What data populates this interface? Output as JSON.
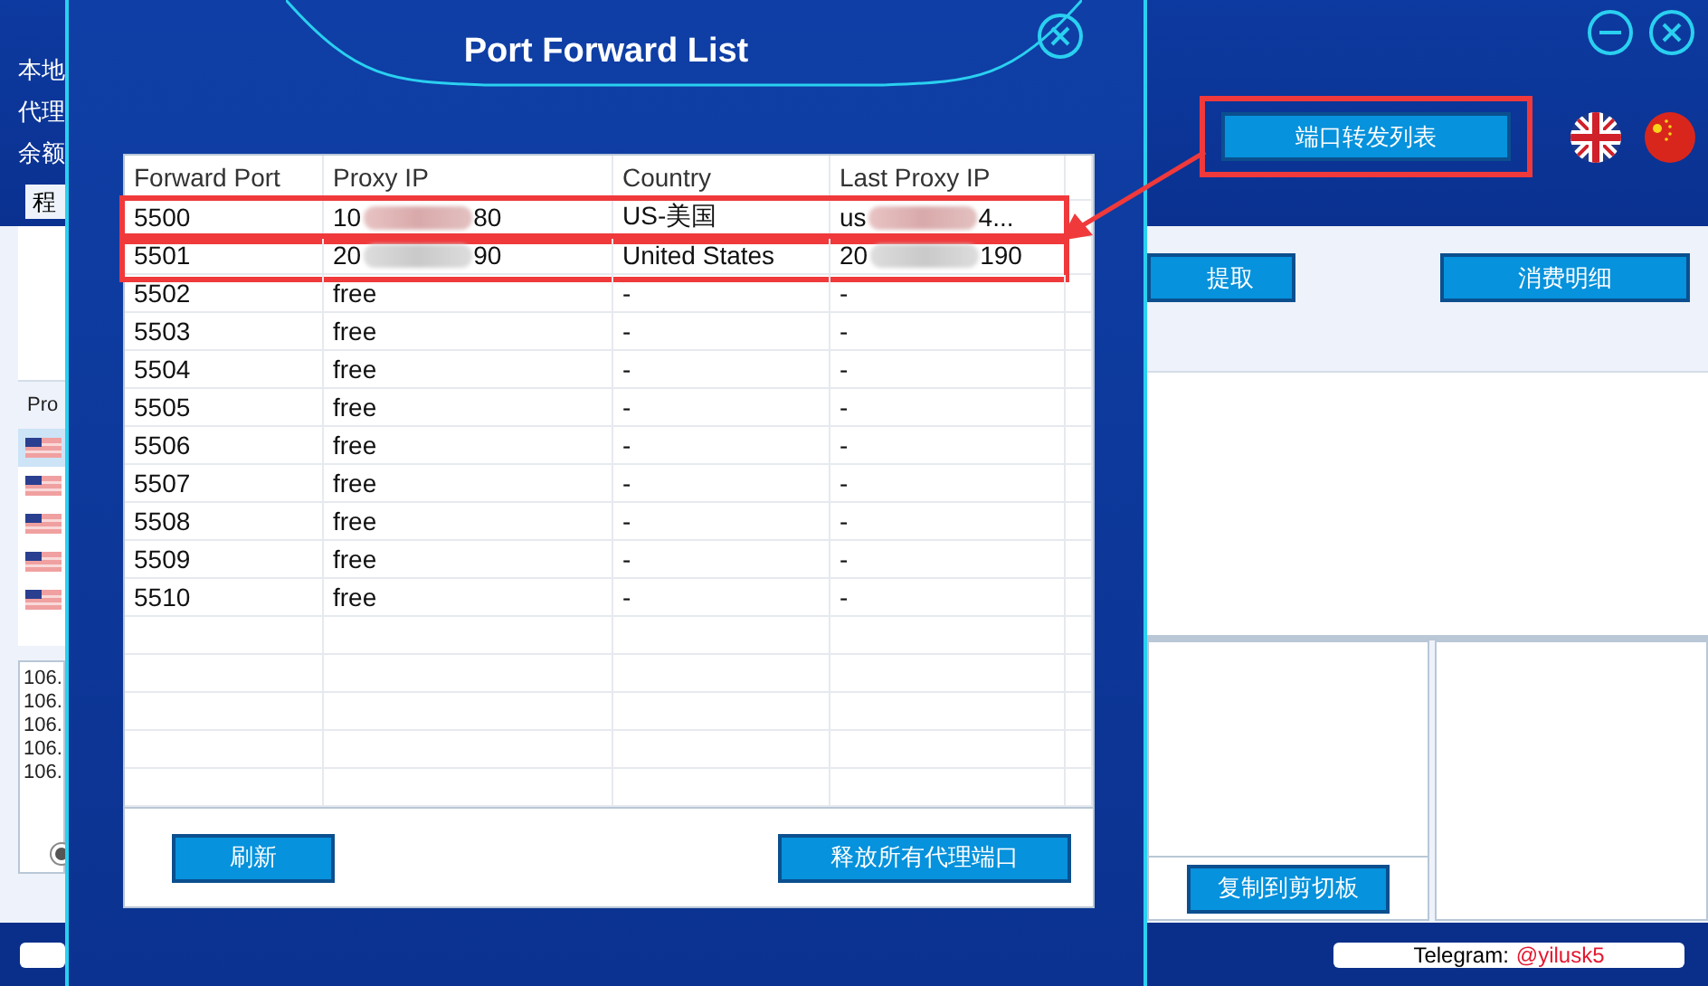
{
  "app": {
    "side_labels": [
      "本地",
      "代理",
      "余额"
    ],
    "tab": "程",
    "list_header": "Pro",
    "list_rows": [
      {
        "selected": true
      },
      {
        "selected": false
      },
      {
        "selected": false
      },
      {
        "selected": false
      },
      {
        "selected": false
      }
    ],
    "log_lines": [
      "106.",
      "106.",
      "106.",
      "106.",
      "106."
    ],
    "radio": {
      "selected": true
    },
    "port_forward_button": {
      "label": "端口转发列表",
      "annotated": true
    },
    "extract_button": "提取",
    "details_button": "消费明细",
    "copy_button": "复制到剪切板",
    "telegram": {
      "label": "Telegram:",
      "handle": "@yilusk5"
    }
  },
  "modal": {
    "title": "Port Forward List",
    "columns": [
      "Forward Port",
      "Proxy IP",
      "Country",
      "Last Proxy IP"
    ],
    "rows": [
      {
        "port": "5500",
        "proxy_ip": {
          "head": "10",
          "tail": "80"
        },
        "country": "US-美国",
        "last_proxy_ip": {
          "head": "us",
          "tail": "4..."
        },
        "highlighted": true
      },
      {
        "port": "5501",
        "proxy_ip": {
          "head": "20",
          "tail": "90"
        },
        "country": "United States",
        "last_proxy_ip": {
          "head": "20",
          "tail": "190"
        },
        "highlighted": true
      },
      {
        "port": "5502",
        "proxy_ip": {
          "head": "free"
        },
        "country": "-",
        "last_proxy_ip": {
          "head": "-"
        },
        "highlighted": false
      },
      {
        "port": "5503",
        "proxy_ip": {
          "head": "free"
        },
        "country": "-",
        "last_proxy_ip": {
          "head": "-"
        },
        "highlighted": false
      },
      {
        "port": "5504",
        "proxy_ip": {
          "head": "free"
        },
        "country": "-",
        "last_proxy_ip": {
          "head": "-"
        },
        "highlighted": false
      },
      {
        "port": "5505",
        "proxy_ip": {
          "head": "free"
        },
        "country": "-",
        "last_proxy_ip": {
          "head": "-"
        },
        "highlighted": false
      },
      {
        "port": "5506",
        "proxy_ip": {
          "head": "free"
        },
        "country": "-",
        "last_proxy_ip": {
          "head": "-"
        },
        "highlighted": false
      },
      {
        "port": "5507",
        "proxy_ip": {
          "head": "free"
        },
        "country": "-",
        "last_proxy_ip": {
          "head": "-"
        },
        "highlighted": false
      },
      {
        "port": "5508",
        "proxy_ip": {
          "head": "free"
        },
        "country": "-",
        "last_proxy_ip": {
          "head": "-"
        },
        "highlighted": false
      },
      {
        "port": "5509",
        "proxy_ip": {
          "head": "free"
        },
        "country": "-",
        "last_proxy_ip": {
          "head": "-"
        },
        "highlighted": false
      },
      {
        "port": "5510",
        "proxy_ip": {
          "head": "free"
        },
        "country": "-",
        "last_proxy_ip": {
          "head": "-"
        },
        "highlighted": false
      }
    ],
    "buttons": [
      "刷新",
      "释放所有代理端口"
    ]
  }
}
